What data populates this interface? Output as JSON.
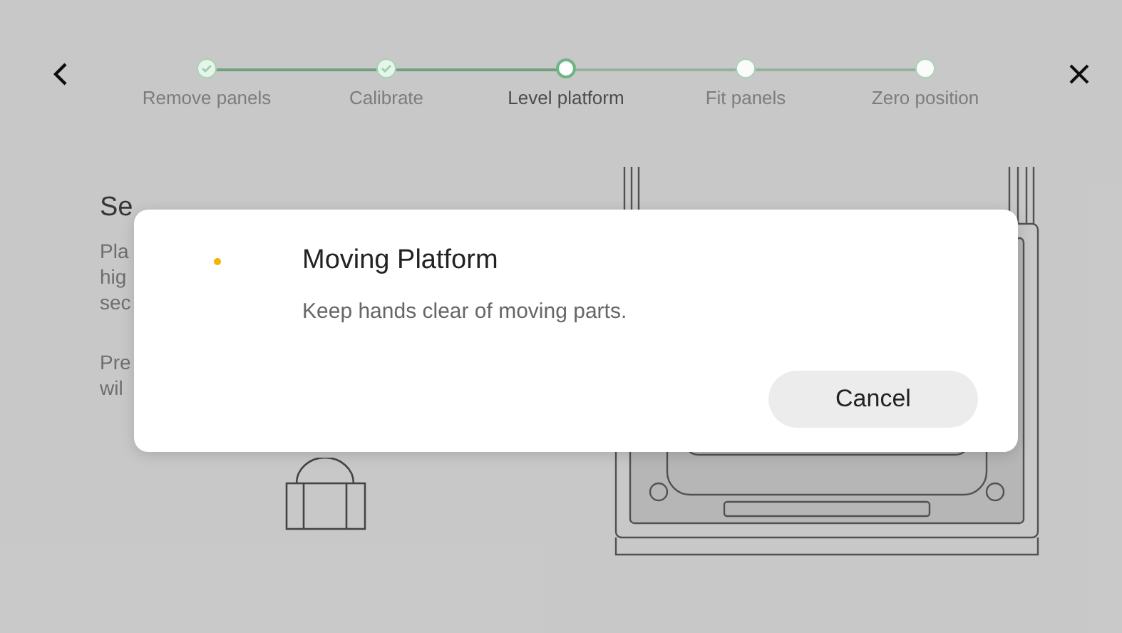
{
  "steps": [
    {
      "label": "Remove panels",
      "completed": true,
      "current": false
    },
    {
      "label": "Calibrate",
      "completed": true,
      "current": false
    },
    {
      "label": "Level platform",
      "completed": false,
      "current": true
    },
    {
      "label": "Fit panels",
      "completed": false,
      "current": false
    },
    {
      "label": "Zero position",
      "completed": false,
      "current": false
    }
  ],
  "instructions": {
    "title": "Se",
    "lines": [
      "Pla",
      "hig",
      "sec"
    ],
    "lines_2": [
      "Pre",
      "wil"
    ]
  },
  "dialog": {
    "title": "Moving Platform",
    "message": "Keep hands clear of moving parts.",
    "cancel": "Cancel",
    "color": "#f5b400"
  }
}
